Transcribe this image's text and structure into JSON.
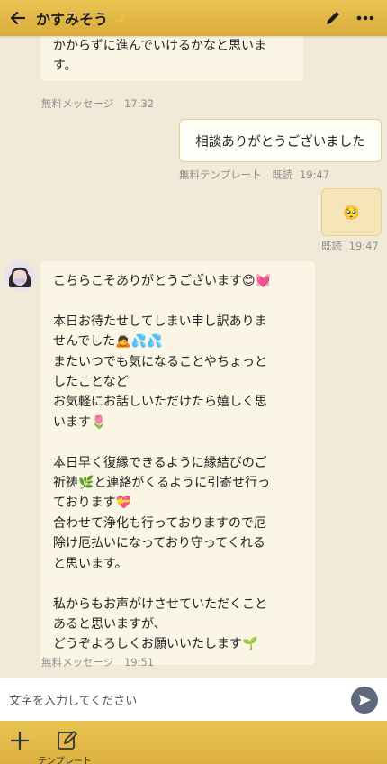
{
  "header": {
    "title": "かすみそう",
    "title_badge": "🌙"
  },
  "messages": {
    "m1": {
      "text": "かからずに進んでいけるかなと思いま\nす。"
    },
    "m1_meta": {
      "label": "無料メッセージ",
      "time": "17:32"
    },
    "m2": {
      "text": "相談ありがとうございました"
    },
    "m2_meta": {
      "label": "無料テンプレート",
      "read": "既読",
      "time": "19:47"
    },
    "m3": {
      "text": "🥺"
    },
    "m3_meta": {
      "read": "既読",
      "time": "19:47"
    },
    "m4": {
      "text": "こちらこそありがとうございます😊💓\n\n本日お待たせしてしまい申し訳ありま\nせんでした🙇💦💦\nまたいつでも気になることやちょっと\nしたことなど\nお気軽にお話しいただけたら嬉しく思\nいます🌷\n\n本日早く復縁できるように縁結びのご\n祈祷🌿と連絡がくるように引寄せ行っ\nております💝\n合わせて浄化も行っておりますので厄\n除け厄払いになっており守ってくれる\nと思います。\n\n私からもお声がけさせていただくこと\nあると思いますが、\nどうぞよろしくお願いいたします🌱"
    },
    "m4_meta": {
      "label": "無料メッセージ",
      "time": "19:51"
    }
  },
  "input": {
    "placeholder": "文字を入力してください"
  },
  "footer": {
    "template_label": "テンプレート"
  },
  "colors": {
    "header": "#e0b745",
    "background": "#f1ead8",
    "send": "#5d6a7c"
  }
}
